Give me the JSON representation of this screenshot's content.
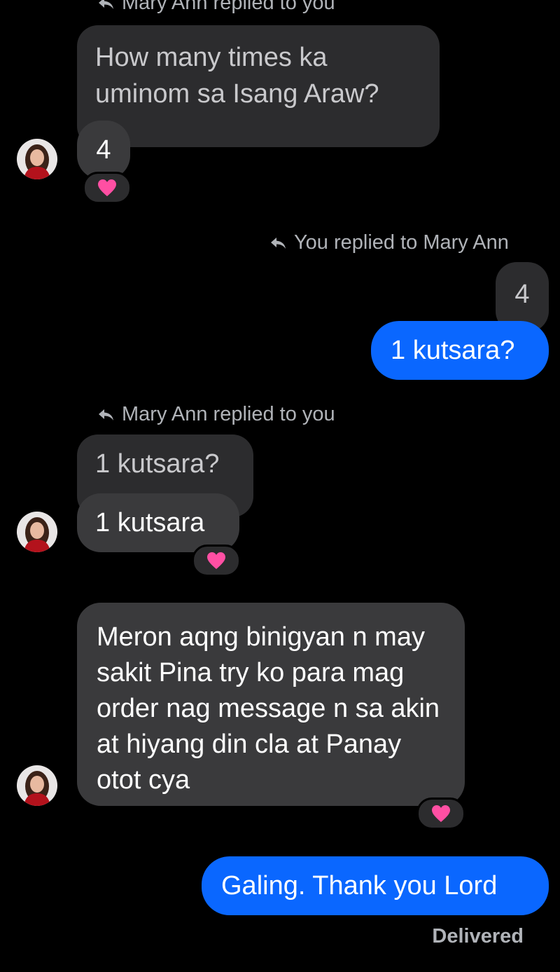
{
  "conversation": {
    "contact_name": "Mary Ann",
    "groups": [
      {
        "reply_label": "Mary Ann replied to you",
        "quoted_text": "How many times ka uminom sa Isang Araw?",
        "message": "4",
        "reaction": "pink-heart"
      },
      {
        "reply_label": "You replied to Mary Ann",
        "quoted_text": "4",
        "message": "1 kutsara?"
      },
      {
        "reply_label": "Mary Ann replied to you",
        "quoted_text": "1 kutsara?",
        "message": "1 kutsara",
        "reaction": "pink-heart"
      },
      {
        "message": "Meron aqng binigyan n may sakit Pina try ko para mag order nag message n sa akin at hiyang din cla at Panay otot cya",
        "reaction": "pink-heart"
      },
      {
        "message": "Galing. Thank you Lord",
        "status": "Delivered"
      }
    ]
  },
  "colors": {
    "background": "#000000",
    "incoming_bubble": "#3a3a3c",
    "quoted_bubble": "#2c2c2e",
    "outgoing_bubble": "#0a67ff",
    "heart": "#ff4fa3",
    "secondary_text": "#b0b3b8"
  }
}
